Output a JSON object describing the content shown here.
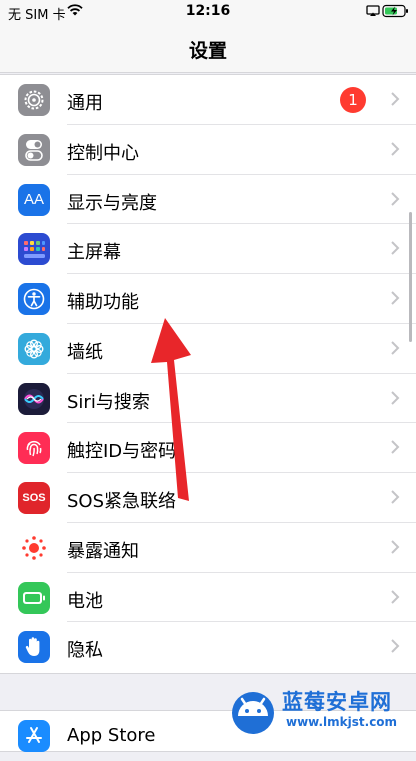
{
  "status_bar": {
    "carrier": "无 SIM 卡",
    "time": "12:16",
    "wifi_icon": "wifi-icon",
    "battery_icon": "battery-charging-icon"
  },
  "nav": {
    "title": "设置"
  },
  "settings_items": [
    {
      "label": "通用",
      "icon": "gear-icon",
      "badge": "1",
      "color": "#8e8e93"
    },
    {
      "label": "控制中心",
      "icon": "toggles-icon",
      "color": "#8e8e93"
    },
    {
      "label": "显示与亮度",
      "icon": "text-size-icon",
      "icon_text": "AA",
      "color": "#1a73e8"
    },
    {
      "label": "主屏幕",
      "icon": "home-grid-icon",
      "color": "#2c4bd1"
    },
    {
      "label": "辅助功能",
      "icon": "accessibility-icon",
      "color": "#1a73e8"
    },
    {
      "label": "墙纸",
      "icon": "flower-icon",
      "color": "#34aadc"
    },
    {
      "label": "Siri与搜索",
      "icon": "siri-icon",
      "color": "#1c1c3a"
    },
    {
      "label": "触控ID与密码",
      "icon": "fingerprint-icon",
      "color": "#ff2d55"
    },
    {
      "label": "SOS紧急联络",
      "icon": "sos-icon",
      "icon_text": "SOS",
      "color": "#e0252b"
    },
    {
      "label": "暴露通知",
      "icon": "exposure-icon",
      "color": "#ff3b30"
    },
    {
      "label": "电池",
      "icon": "battery-icon",
      "color": "#34c759"
    },
    {
      "label": "隐私",
      "icon": "hand-icon",
      "color": "#1a73e8"
    }
  ],
  "app_store_item": {
    "label": "App Store",
    "icon": "app-store-icon",
    "color": "#1a8cff"
  },
  "watermark": {
    "title": "蓝莓安卓网",
    "url": "www.lmkjst.com"
  },
  "annotation": {
    "arrow_color": "#e8262a",
    "arrow_icon": "red-arrow-pointer"
  }
}
